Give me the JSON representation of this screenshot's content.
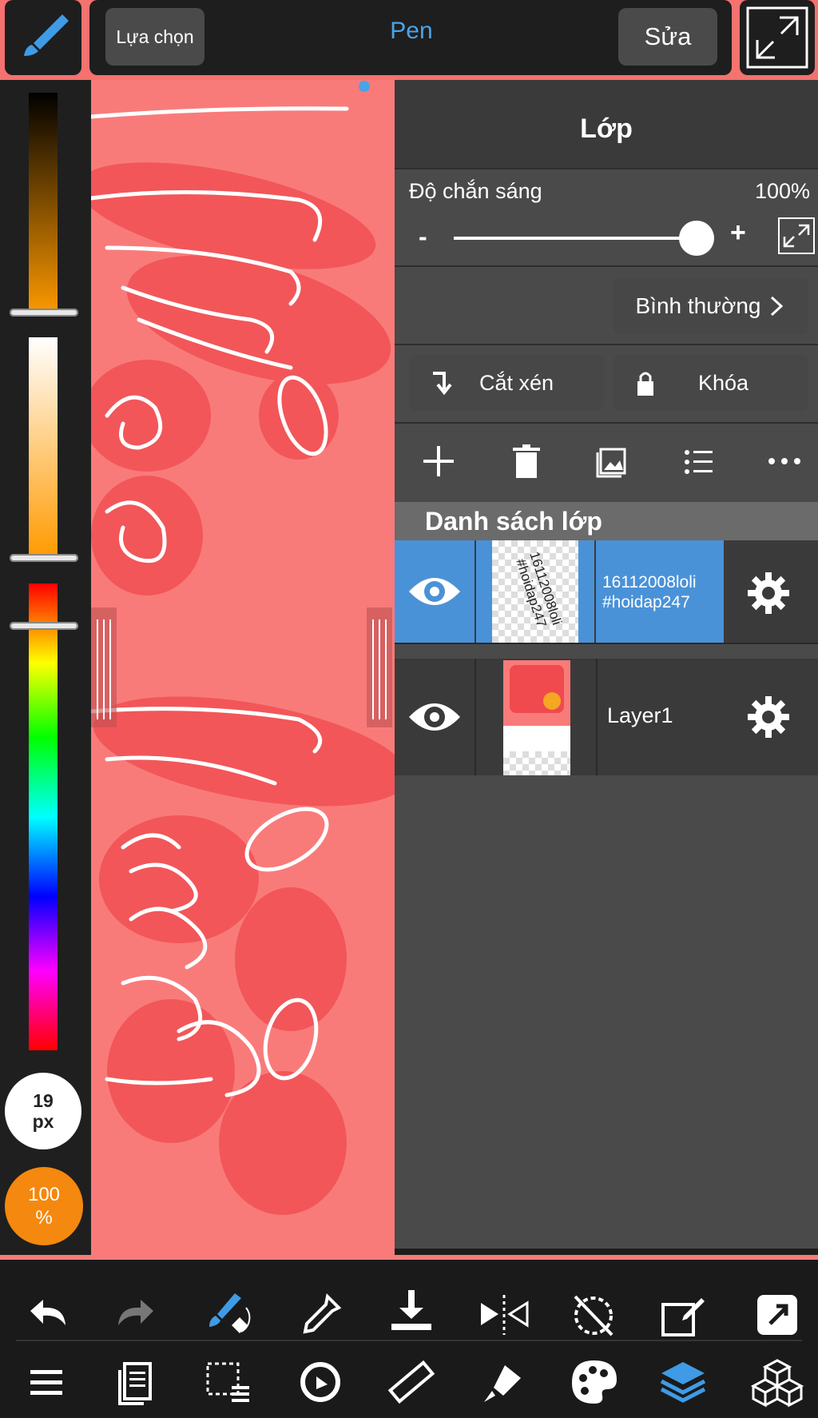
{
  "toolbar": {
    "select_label": "Lựa chọn",
    "tool_name": "Pen",
    "edit_label": "Sửa"
  },
  "color_panel": {
    "brush_size": "19",
    "brush_size_unit": "px",
    "brush_opacity_value": "100",
    "brush_opacity_unit": "%"
  },
  "layers_panel": {
    "title": "Lớp",
    "opacity_label": "Độ chắn sáng",
    "opacity_value": "100%",
    "opacity_fraction": 1.0,
    "minus_label": "-",
    "plus_label": "+",
    "blend_mode": "Bình thường",
    "clip_label": "Cắt xén",
    "lock_label": "Khóa",
    "list_title": "Danh sách lớp",
    "layers": [
      {
        "name_line1": "16112008loli",
        "name_line2": "#hoidap247",
        "thumb_text_1": "16112008loli",
        "thumb_text_2": "#hoidap247",
        "selected": true
      },
      {
        "name": "Layer1",
        "selected": false
      }
    ]
  },
  "colors": {
    "accent": "#4ba3e8",
    "canvas": "#f87b7a",
    "selected_layer": "#4a92d8",
    "opacity_badge": "#f5880e"
  }
}
